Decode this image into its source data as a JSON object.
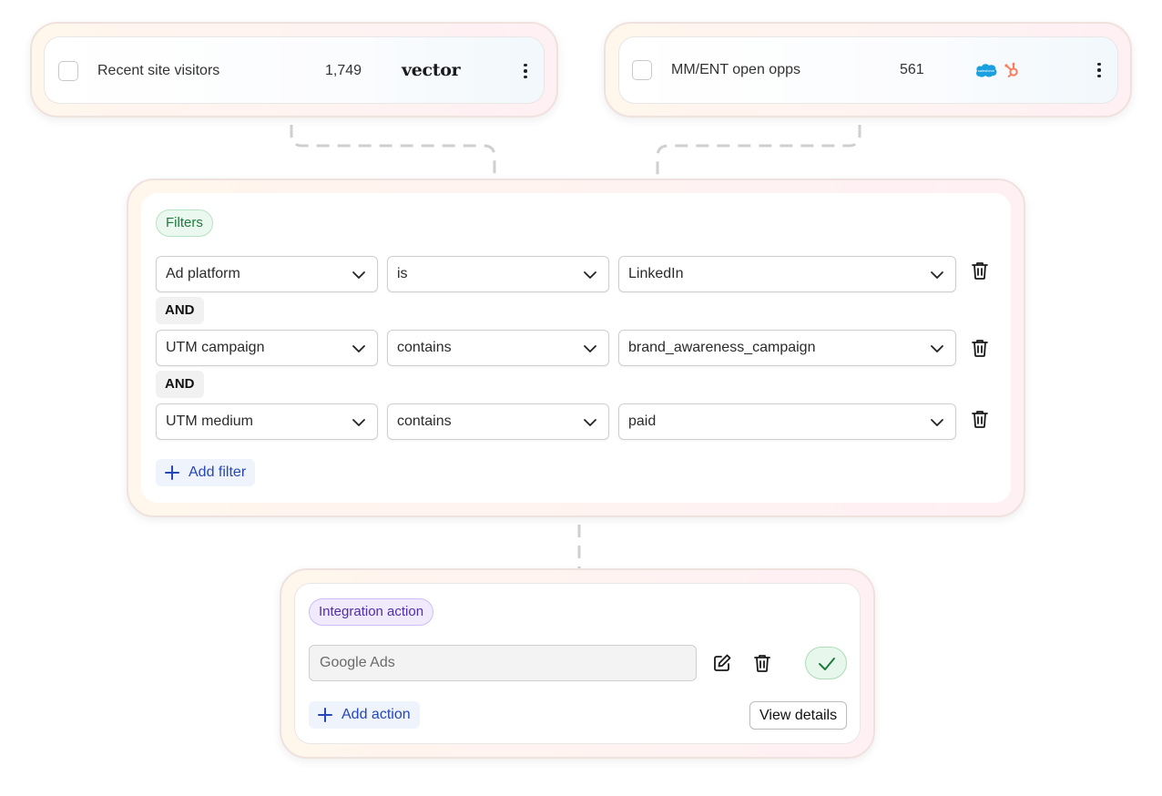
{
  "segments": [
    {
      "title": "Recent site visitors",
      "count": "1,749",
      "source": "vector",
      "source_icons": [
        "vector-logo"
      ]
    },
    {
      "title": "MM/ENT open opps",
      "count": "561",
      "source": "",
      "source_icons": [
        "salesforce-icon",
        "hubspot-icon"
      ]
    }
  ],
  "filters": {
    "badge": "Filters",
    "rows": [
      {
        "field": "Ad platform",
        "operator": "is",
        "value": "LinkedIn"
      },
      {
        "field": "UTM campaign",
        "operator": "contains",
        "value": "brand_awareness_campaign"
      },
      {
        "field": "UTM medium",
        "operator": "contains",
        "value": "paid"
      }
    ],
    "connectors": [
      "AND",
      "AND"
    ],
    "add_label": "Add filter"
  },
  "action": {
    "badge": "Integration action",
    "field_value": "Google Ads",
    "add_label": "Add action",
    "details_label": "View details"
  },
  "colors": {
    "filters_badge": "#1f7a3d",
    "action_badge": "#4f2ea8",
    "link_blue": "#2547b8",
    "salesforce": "#1aa0e0",
    "hubspot": "#ff7a59"
  }
}
